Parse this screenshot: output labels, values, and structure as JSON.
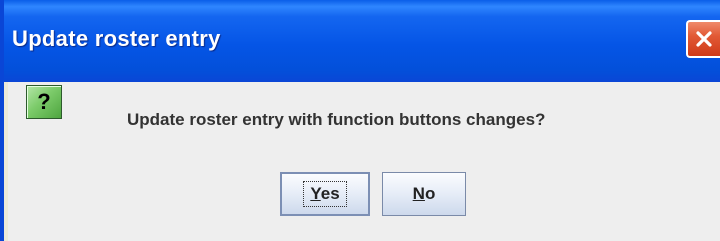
{
  "window": {
    "title": "Update roster entry",
    "close_icon": "close-icon",
    "accent_color": "#0a5ee8",
    "close_color": "#e25a36"
  },
  "dialog": {
    "icon": "question-icon",
    "icon_glyph": "?",
    "message": "Update roster entry with function buttons changes?",
    "buttons": {
      "yes": {
        "mnemonic": "Y",
        "rest": "es"
      },
      "no": {
        "mnemonic": "N",
        "rest": "o"
      }
    }
  }
}
